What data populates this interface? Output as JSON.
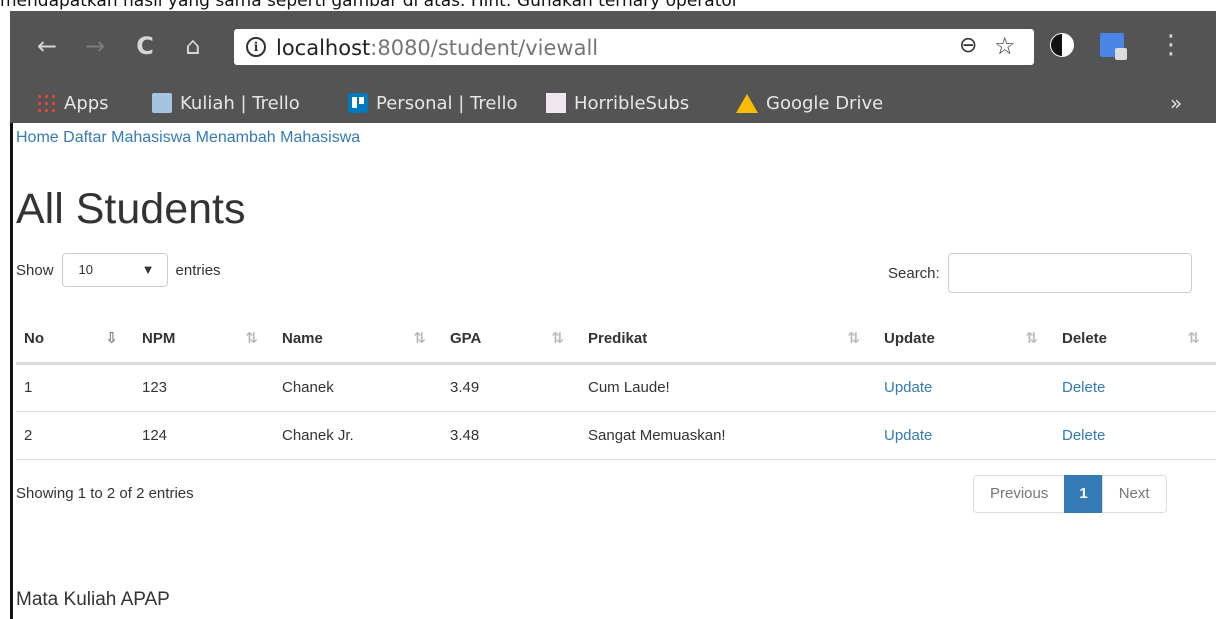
{
  "caption": "mendapatkan hasil yang sama seperti gambar di atas. Hint: Gunakan ternary operator",
  "browser": {
    "url_host": "localhost",
    "url_path": ":8080/student/viewall",
    "nav": {
      "back": "←",
      "forward": "→",
      "reload": "C",
      "home": "⌂"
    },
    "icons": {
      "info": "i",
      "zoom": "⊖",
      "star": "☆",
      "menu": "⋮",
      "more": "»"
    },
    "bookmarks": [
      {
        "label": "Apps",
        "icon": "apps-grid-icon"
      },
      {
        "label": "Kuliah | Trello",
        "icon": "trello-board-icon"
      },
      {
        "label": "Personal | Trello",
        "icon": "trello-logo-icon"
      },
      {
        "label": "HorribleSubs",
        "icon": "horriblesubs-icon"
      },
      {
        "label": "Google Drive",
        "icon": "google-drive-icon"
      }
    ]
  },
  "page": {
    "nav_links": [
      "Home",
      "Daftar Mahasiswa",
      "Menambah Mahasiswa"
    ],
    "title": "All Students",
    "show_label": "Show",
    "entries_label": "entries",
    "page_length": "10",
    "caret": "▼",
    "search_label": "Search:",
    "search_value": "",
    "table": {
      "columns": [
        "No",
        "NPM",
        "Name",
        "GPA",
        "Predikat",
        "Update",
        "Delete"
      ],
      "sort_active": "⇩",
      "sort_idle": "⇅",
      "rows": [
        {
          "no": "1",
          "npm": "123",
          "name": "Chanek",
          "gpa": "3.49",
          "predikat": "Cum Laude!",
          "update": "Update",
          "delete": "Delete"
        },
        {
          "no": "2",
          "npm": "124",
          "name": "Chanek Jr.",
          "gpa": "3.48",
          "predikat": "Sangat Memuaskan!",
          "update": "Update",
          "delete": "Delete"
        }
      ]
    },
    "info": "Showing 1 to 2 of 2 entries",
    "pagination": {
      "previous": "Previous",
      "current": "1",
      "next": "Next"
    },
    "footer": "Mata Kuliah APAP"
  }
}
